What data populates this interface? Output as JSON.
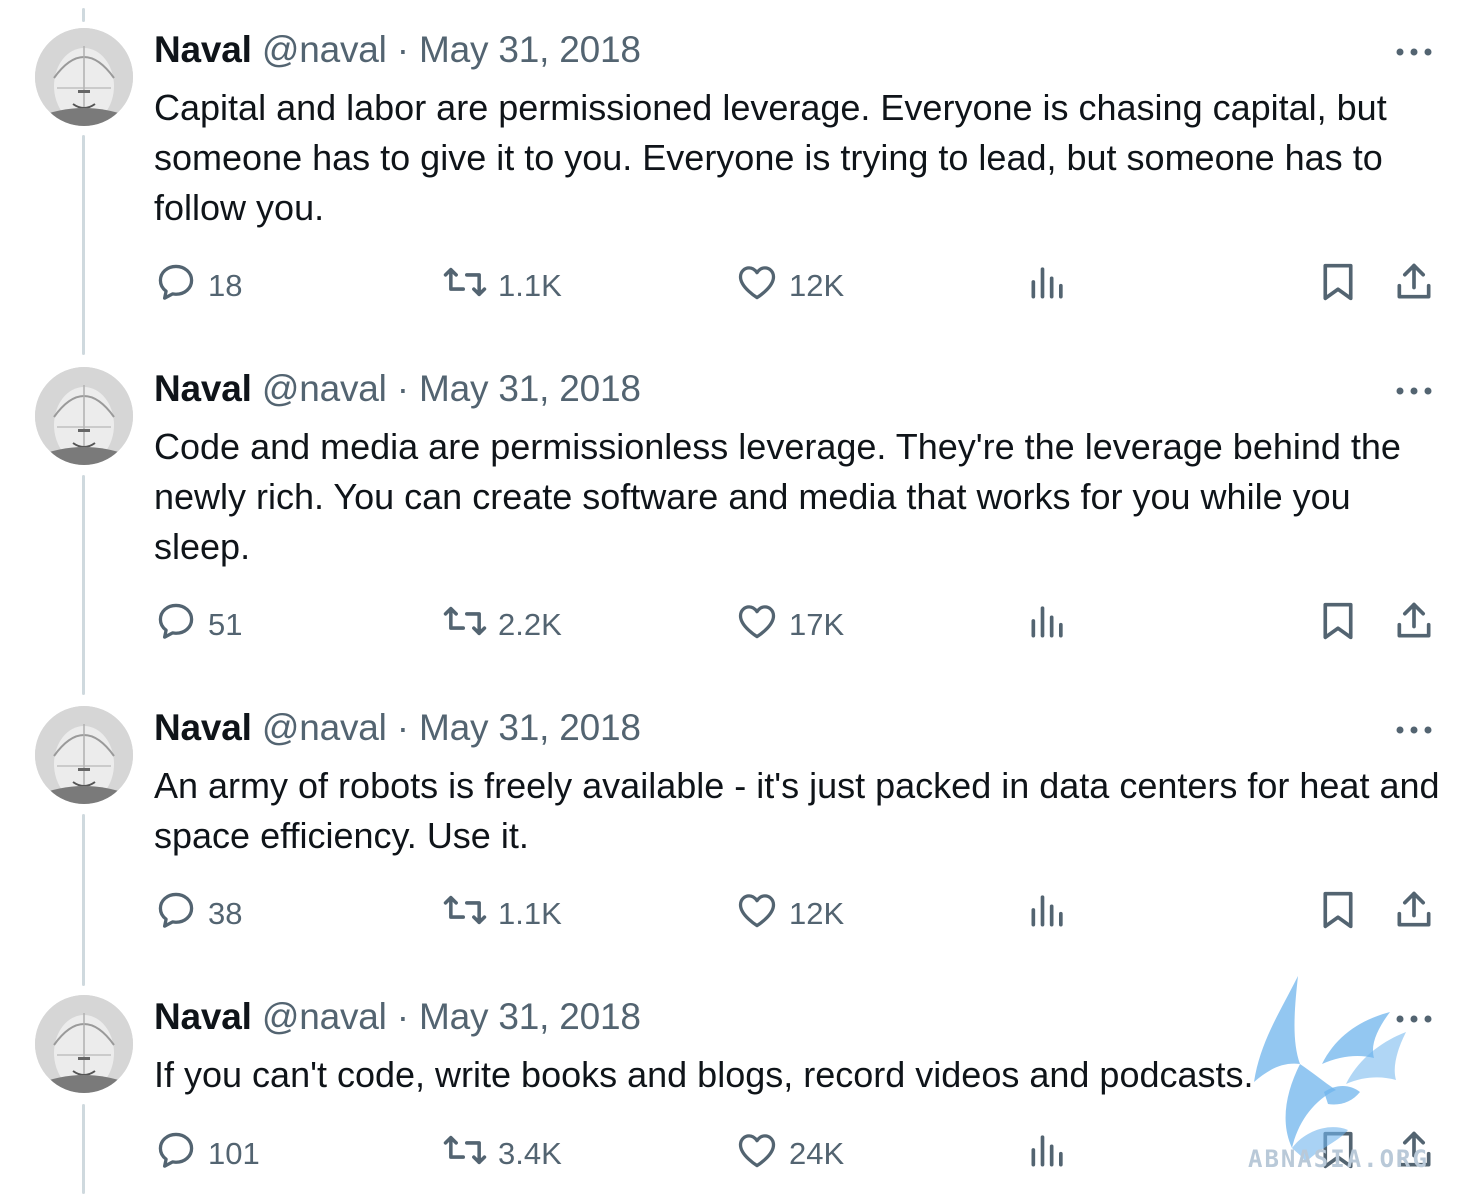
{
  "tweets": [
    {
      "name": "Naval",
      "handle": "@naval",
      "separator": "·",
      "date": "May 31, 2018",
      "text": "Capital and labor are permissioned leverage. Everyone is chasing capital, but someone has to give it to you. Everyone is trying to lead, but someone has to follow you.",
      "replies": "18",
      "retweets": "1.1K",
      "likes": "12K"
    },
    {
      "name": "Naval",
      "handle": "@naval",
      "separator": "·",
      "date": "May 31, 2018",
      "text": "Code and media are permissionless leverage. They're the leverage behind the newly rich. You can create software and media that works for you while you sleep.",
      "replies": "51",
      "retweets": "2.2K",
      "likes": "17K"
    },
    {
      "name": "Naval",
      "handle": "@naval",
      "separator": "·",
      "date": "May 31, 2018",
      "text": "An army of robots is freely available - it's just packed in data centers for heat and space efficiency. Use it.",
      "replies": "38",
      "retweets": "1.1K",
      "likes": "12K"
    },
    {
      "name": "Naval",
      "handle": "@naval",
      "separator": "·",
      "date": "May 31, 2018",
      "text": "If you can't code, write books and blogs, record videos and podcasts.",
      "replies": "101",
      "retweets": "3.4K",
      "likes": "24K"
    }
  ],
  "icons": {
    "more": "more-icon",
    "reply": "reply-icon",
    "retweet": "retweet-icon",
    "like": "heart-icon",
    "views": "views-icon",
    "bookmark": "bookmark-icon",
    "share": "share-icon"
  },
  "colors": {
    "text": "#0f1419",
    "secondary": "#536471",
    "thread_line": "#cfd9de",
    "watermark": "#5fa8e8"
  },
  "watermark": {
    "text": "ABNASIA.ORG"
  }
}
